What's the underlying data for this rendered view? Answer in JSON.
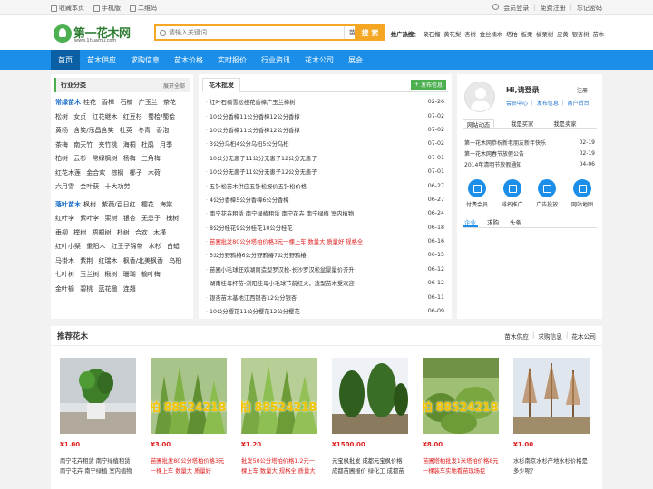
{
  "topbar": {
    "left": [
      "收藏本页",
      "手机版",
      "二维码"
    ],
    "right": [
      "会员登录",
      "免费注册",
      "忘记密码"
    ]
  },
  "logo": {
    "text": "第一花木网",
    "sub": "www.1huamu.com"
  },
  "search": {
    "placeholder": "请输入关键词",
    "category": "苗木供应",
    "button": "搜 索"
  },
  "hot": {
    "label": "推广热搜：",
    "words": [
      "栾石榴",
      "黄花梨",
      "杏树",
      "金丝楠木",
      "塔柏",
      "板栗",
      "榆栗树",
      "皮黄",
      "银杏树",
      "苗木"
    ]
  },
  "nav": [
    "首页",
    "苗木供应",
    "求购信息",
    "苗木价格",
    "实时报价",
    "行业资讯",
    "花木公司",
    "展会"
  ],
  "category": {
    "title": "行业分类",
    "more": "展开全部",
    "groups": [
      {
        "name": "常绿苗木",
        "items": [
          "桂花",
          "香樟",
          "石楠",
          "广玉兰",
          "茶花",
          "松树",
          "女贞",
          "红花继木",
          "红豆杉",
          "蜀桧/蜀侩",
          "黄杨",
          "含笑/乐昌含笑",
          "杜英",
          "冬青",
          "香泡",
          "茶梅",
          "南天竹",
          "夹竹桃",
          "海桐",
          "杜鹃",
          "月季",
          "柏树",
          "云杉",
          "常绿枫树",
          "杨梅",
          "三角梅",
          "红花木莲",
          "金合欢",
          "棕榈",
          "椰子",
          "木荷",
          "六月雪",
          "金叶获",
          "十大功劳"
        ]
      },
      {
        "name": "落叶苗木",
        "items": [
          "枫树",
          "紫薇/百日红",
          "樱花",
          "海棠",
          "红叶李",
          "紫叶李",
          "栾树",
          "银杏",
          "无患子",
          "槐树",
          "垂柳",
          "榉树",
          "梧桐树",
          "朴树",
          "合欢",
          "木槿",
          "红叶小檗",
          "重阳木",
          "红王子锦带",
          "水杉",
          "白蜡",
          "马褂木",
          "紫荆",
          "红瑞木",
          "枫香/北美枫香",
          "乌桕",
          "七叶树",
          "玉兰树",
          "楸树",
          "珊瑚",
          "榆叶梅",
          "金叶榆",
          "碧桃",
          "蓝花楹",
          "连翘"
        ]
      }
    ]
  },
  "pricelist": {
    "tab": "花木批发",
    "publish": "发布信息",
    "items": [
      {
        "title": "红叶石楠雪松桂花香樟广玉兰樟树",
        "date": "02-26",
        "hot": false
      },
      {
        "title": "10公分香樟11公分香樟12公分香樟",
        "date": "07-02",
        "hot": false
      },
      {
        "title": "10公分香樟11公分香樟12公分香樟",
        "date": "07-02",
        "hot": false
      },
      {
        "title": "3公分乌桕4公分乌桕5公分乌桕",
        "date": "07-02",
        "hot": false
      },
      {
        "title": "10公分无患子11公分无患子12公分无患子",
        "date": "07-01",
        "hot": false
      },
      {
        "title": "10公分无患子11公分无患子12公分无患子",
        "date": "07-01",
        "hot": false
      },
      {
        "title": "五针松苗木供应五针松报价五针松价格",
        "date": "06-27",
        "hot": false
      },
      {
        "title": "4公分香樟5公分香樟6公分香樟",
        "date": "06-27",
        "hot": false
      },
      {
        "title": "南宁花卉租赁 南宁绿植租赁 南宁花卉 南宁绿植 室内植物",
        "date": "06-24",
        "hot": false
      },
      {
        "title": "8公分桂花9公分桂花10公分桂花",
        "date": "06-18",
        "hot": false
      },
      {
        "title": "苗圃批发80公分塔柏价格3元一棵上车 数量大 质量好 规格全",
        "date": "06-16",
        "hot": true
      },
      {
        "title": "5公分野鸦椿6公分野鸦椿7公分野鸦椿",
        "date": "06-15",
        "hot": false
      },
      {
        "title": "苗圃小毛球狂欢湖南造型罗汉松-长沙罗汉松盆景量价齐升",
        "date": "06-12",
        "hot": false
      },
      {
        "title": "湖南桂母杯苗-浏阳桂母小毛球节前红火，造型苗木受欢迎",
        "date": "06-12",
        "hot": false
      },
      {
        "title": "银杏苗木基地江西银杏12公分银杏",
        "date": "06-11",
        "hot": false
      },
      {
        "title": "10公分樱花11公分樱花12公分樱花",
        "date": "06-09",
        "hot": false
      }
    ]
  },
  "user": {
    "greeting": "Hi,请登录",
    "register": "注册",
    "links": "会员中心 ｜ 发布信息 ｜ 商户后台",
    "tabs": [
      "网站动态",
      "我是买家",
      "我是卖家"
    ],
    "notices": [
      {
        "title": "第一花木网恭祝新老朋友新年快乐",
        "date": "02-19"
      },
      {
        "title": "第一花木网春节放假公告",
        "date": "02-19"
      },
      {
        "title": "2014年清明节放假通知",
        "date": "04-06"
      }
    ],
    "quick": [
      "付费会员",
      "排名推广",
      "广告投放",
      "网站地图"
    ],
    "bottom_tabs": [
      "企业",
      "求购",
      "头条"
    ]
  },
  "recommend": {
    "title": "推荐花木",
    "links": [
      "苗木供应",
      "求购信息",
      "花木公司"
    ],
    "watermark": "柏 885242188",
    "items": [
      {
        "price": "¥1.00",
        "name": "南宁花卉租赁 南宁绿植租赁 南宁花卉 南宁绿植 室内植物",
        "hot": false
      },
      {
        "price": "¥3.00",
        "name": "苗圃批发80公分塔柏价格3元一棵上车 数量大 质量好",
        "hot": true
      },
      {
        "price": "¥1.20",
        "name": "批发50公分塔柏价格1.2元一棵上车 数量大 规格全 质量大",
        "hot": true
      },
      {
        "price": "¥1500.00",
        "name": "元宝枫批发 成都元宝枫价格 成都苗圃报价 绿化工 成都苗木价",
        "hot": false
      },
      {
        "price": "¥8.00",
        "name": "苗圃塔柏批发1米塔柏价格8元一棵装车实地看苗现场挖",
        "hot": true
      },
      {
        "price": "¥1.00",
        "name": "水杉南京水杉产地水杉价格是多少呢？",
        "hot": false
      }
    ]
  }
}
